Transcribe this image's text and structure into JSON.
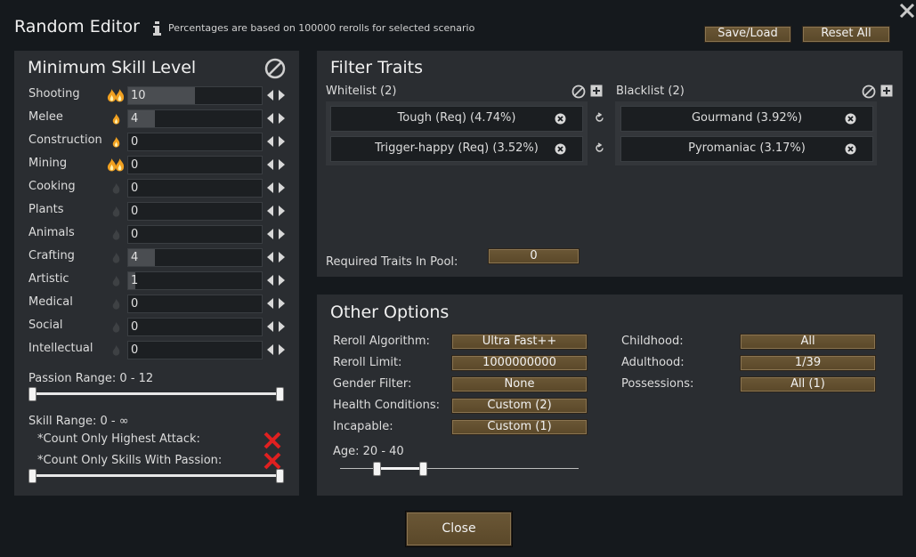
{
  "header": {
    "title": "Random Editor",
    "info_text": "Percentages are based on 100000 rerolls for selected scenario",
    "save_load": "Save/Load",
    "reset_all": "Reset All"
  },
  "skills_panel": {
    "title": "Minimum Skill Level",
    "skills": [
      {
        "name": "Shooting",
        "value": "10",
        "level": 10,
        "passion": "major"
      },
      {
        "name": "Melee",
        "value": "4",
        "level": 4,
        "passion": "minor"
      },
      {
        "name": "Construction",
        "value": "0",
        "level": 0,
        "passion": "minor"
      },
      {
        "name": "Mining",
        "value": "0",
        "level": 0,
        "passion": "major"
      },
      {
        "name": "Cooking",
        "value": "0",
        "level": 0,
        "passion": "none"
      },
      {
        "name": "Plants",
        "value": "0",
        "level": 0,
        "passion": "none"
      },
      {
        "name": "Animals",
        "value": "0",
        "level": 0,
        "passion": "none"
      },
      {
        "name": "Crafting",
        "value": "4",
        "level": 4,
        "passion": "none"
      },
      {
        "name": "Artistic",
        "value": "1",
        "level": 1,
        "passion": "none"
      },
      {
        "name": "Medical",
        "value": "0",
        "level": 0,
        "passion": "none"
      },
      {
        "name": "Social",
        "value": "0",
        "level": 0,
        "passion": "none"
      },
      {
        "name": "Intellectual",
        "value": "0",
        "level": 0,
        "passion": "none"
      }
    ],
    "passion_range_label": "Passion Range: 0 - 12",
    "skill_range_label": "Skill Range: 0 - ∞",
    "count_highest_attack": "*Count Only Highest Attack:",
    "count_skills_passion": "*Count Only Skills With Passion:"
  },
  "traits_panel": {
    "title": "Filter Traits",
    "whitelist_label": "Whitelist (2)",
    "blacklist_label": "Blacklist (2)",
    "whitelist": [
      "Tough (Req) (4.74%)",
      "Trigger-happy (Req) (3.52%)"
    ],
    "blacklist": [
      "Gourmand (3.92%)",
      "Pyromaniac (3.17%)"
    ],
    "required_label": "Required Traits In Pool:",
    "required_value": "0"
  },
  "options_panel": {
    "title": "Other Options",
    "left": [
      {
        "label": "Reroll Algorithm:",
        "value": "Ultra Fast++"
      },
      {
        "label": "Reroll Limit:",
        "value": "1000000000"
      },
      {
        "label": "Gender Filter:",
        "value": "None"
      },
      {
        "label": "Health Conditions:",
        "value": "Custom (2)"
      },
      {
        "label": "Incapable:",
        "value": "Custom (1)"
      }
    ],
    "right": [
      {
        "label": "Childhood:",
        "value": "All"
      },
      {
        "label": "Adulthood:",
        "value": "1/39"
      },
      {
        "label": "Possessions:",
        "value": "All (1)"
      }
    ],
    "age_label": "Age: 20 - 40"
  },
  "footer": {
    "close": "Close"
  },
  "colors": {
    "button_bg": "#5f4c2d",
    "panel_bg": "#2a2d31",
    "window_bg": "#15191d",
    "passion_flame": "#f0a020",
    "toggle_off": "#e02020"
  }
}
